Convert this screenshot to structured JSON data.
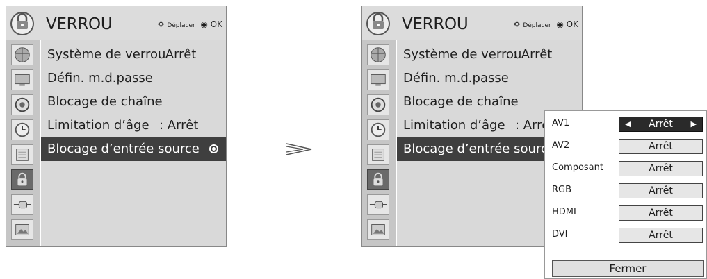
{
  "screen": {
    "title": "VERROU",
    "help_move": "Déplacer",
    "help_ok": "OK",
    "menu_items": [
      {
        "label": "Système de verrou",
        "value": ": Arrêt"
      },
      {
        "label": "Défin. m.d.passe",
        "value": ""
      },
      {
        "label": "Blocage de chaîne",
        "value": ""
      },
      {
        "label": "Limitation d’âge",
        "value": ": Arrêt"
      },
      {
        "label": "Blocage d’entrée source",
        "value": ""
      }
    ],
    "sidebar_icons": [
      "globe-icon",
      "monitor-icon",
      "speaker-icon",
      "clock-icon",
      "calendar-icon",
      "lock-icon",
      "plug-icon",
      "picture-icon"
    ],
    "selected_icon": "lock-icon"
  },
  "popup": {
    "rows": [
      {
        "label": "AV1",
        "value": "Arrêt"
      },
      {
        "label": "AV2",
        "value": "Arrêt"
      },
      {
        "label": "Composant",
        "value": "Arrêt"
      },
      {
        "label": "RGB",
        "value": "Arrêt"
      },
      {
        "label": "HDMI",
        "value": "Arrêt"
      },
      {
        "label": "DVI",
        "value": "Arrêt"
      }
    ],
    "close_label": "Fermer"
  },
  "arrow_symbol": "≫",
  "colors": {
    "selected_bg": "#3f3f3f",
    "menu_bg": "#d9d9d9",
    "icon_column_bg": "#c6c6c6"
  }
}
